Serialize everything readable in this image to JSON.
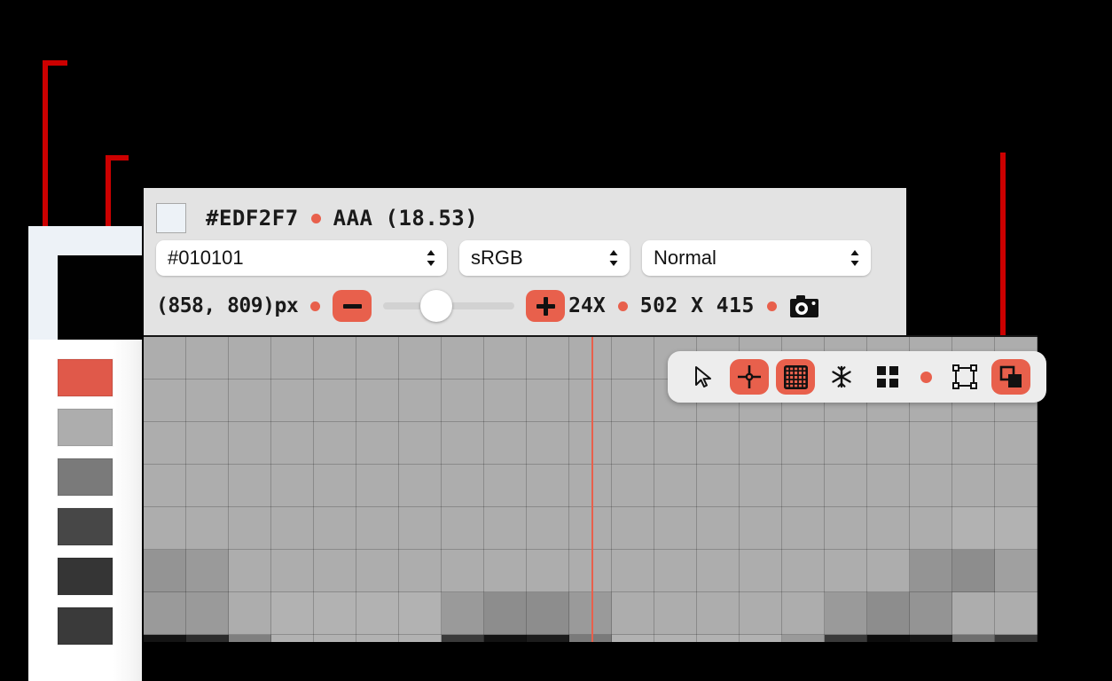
{
  "annotations": {
    "color": "#CC0000",
    "leaders": [
      {
        "name": "leader-palette-panel"
      },
      {
        "name": "leader-active-color-swatch"
      },
      {
        "name": "leader-layers-tool"
      }
    ]
  },
  "sidebar": {
    "active_color": "#010101",
    "panel_background": "#EDF2F7",
    "swatches": [
      {
        "name": "swatch-coral",
        "color": "#E0594A"
      },
      {
        "name": "swatch-light-gray",
        "color": "#ADADAD"
      },
      {
        "name": "swatch-mid-gray",
        "color": "#7A7A7A"
      },
      {
        "name": "swatch-dark-gray",
        "color": "#474747"
      },
      {
        "name": "swatch-darker-gray",
        "color": "#353535"
      },
      {
        "name": "swatch-near-black",
        "color": "#3A3A3A"
      }
    ]
  },
  "header": {
    "preview_color": "#EDF2F7",
    "hex_label": "#EDF2F7",
    "contrast_grade": "AAA",
    "contrast_ratio": "(18.53)",
    "accent_color": "#E8604C",
    "selects": [
      {
        "name": "color-hex-select",
        "value": "#010101",
        "icon": "chevron-updown-icon"
      },
      {
        "name": "color-space-select",
        "value": "sRGB",
        "icon": "chevron-updown-icon"
      },
      {
        "name": "blend-mode-select",
        "value": "Normal",
        "icon": "chevron-updown-icon"
      }
    ],
    "zoom_row": {
      "coordinates": "(858, 809)px",
      "zoom_out_icon": "minus-icon",
      "zoom_in_icon": "plus-icon",
      "zoom_level": "24X",
      "dimensions": "502 X 415",
      "camera_icon": "camera-icon",
      "slider_value": 30
    }
  },
  "toolbar": {
    "items": [
      {
        "name": "cursor-tool",
        "icon": "cursor-arrow-icon",
        "active": false
      },
      {
        "name": "crosshair-tool",
        "icon": "crosshair-icon",
        "active": true
      },
      {
        "name": "grid-tool",
        "icon": "grid-icon",
        "active": true
      },
      {
        "name": "freeze-tool",
        "icon": "snowflake-icon",
        "active": false
      },
      {
        "name": "quad-tool",
        "icon": "four-squares-icon",
        "active": false
      },
      {
        "name": "separator-dot",
        "icon": "dot-icon",
        "active": false
      },
      {
        "name": "crop-tool",
        "icon": "bounding-box-icon",
        "active": false
      },
      {
        "name": "layers-tool",
        "icon": "overlap-squares-icon",
        "active": true
      }
    ]
  },
  "canvas": {
    "grid_cell_size": 48,
    "columns": 21,
    "rows": 8,
    "crosshair_color": "#E8604C",
    "base_color": "#ADADAD",
    "pixels": [
      [
        "#ADADAD",
        "#ADADAD",
        "#ADADAD",
        "#ADADAD",
        "#ADADAD",
        "#ADADAD",
        "#ADADAD",
        "#ADADAD",
        "#ADADAD",
        "#ADADAD",
        "#ADADAD",
        "#ADADAD",
        "#ADADAD",
        "#ADADAD",
        "#ADADAD",
        "#ADADAD",
        "#ADADAD",
        "#ADADAD",
        "#ADADAD",
        "#ADADAD",
        "#ADADAD"
      ],
      [
        "#ADADAD",
        "#ADADAD",
        "#ADADAD",
        "#ADADAD",
        "#ADADAD",
        "#ADADAD",
        "#ADADAD",
        "#ADADAD",
        "#ADADAD",
        "#ADADAD",
        "#ADADAD",
        "#ADADAD",
        "#ADADAD",
        "#ADADAD",
        "#ADADAD",
        "#ADADAD",
        "#ADADAD",
        "#ADADAD",
        "#ADADAD",
        "#ADADAD",
        "#ADADAD"
      ],
      [
        "#ADADAD",
        "#ADADAD",
        "#ADADAD",
        "#ADADAD",
        "#ADADAD",
        "#ADADAD",
        "#ADADAD",
        "#ADADAD",
        "#ADADAD",
        "#ADADAD",
        "#ADADAD",
        "#ADADAD",
        "#ADADAD",
        "#ADADAD",
        "#ADADAD",
        "#ADADAD",
        "#ADADAD",
        "#ADADAD",
        "#ADADAD",
        "#ADADAD",
        "#ADADAD"
      ],
      [
        "#ADADAD",
        "#ADADAD",
        "#ADADAD",
        "#ADADAD",
        "#ADADAD",
        "#ADADAD",
        "#ADADAD",
        "#ADADAD",
        "#ADADAD",
        "#ADADAD",
        "#ADADAD",
        "#ADADAD",
        "#ADADAD",
        "#ADADAD",
        "#ADADAD",
        "#ADADAD",
        "#ADADAD",
        "#ADADAD",
        "#ADADAD",
        "#ADADAD",
        "#ADADAD"
      ],
      [
        "#ADADAD",
        "#ADADAD",
        "#ADADAD",
        "#ADADAD",
        "#ADADAD",
        "#ADADAD",
        "#ADADAD",
        "#ADADAD",
        "#ADADAD",
        "#ADADAD",
        "#ADADAD",
        "#ADADAD",
        "#ADADAD",
        "#ADADAD",
        "#ADADAD",
        "#ADADAD",
        "#ADADAD",
        "#ADADAD",
        "#ADADAD",
        "#B2B2B2",
        "#B2B2B2"
      ],
      [
        "#949494",
        "#9A9A9A",
        "#ADADAD",
        "#ADADAD",
        "#ADADAD",
        "#ADADAD",
        "#ADADAD",
        "#ADADAD",
        "#ADADAD",
        "#ADADAD",
        "#ADADAD",
        "#ADADAD",
        "#ADADAD",
        "#ADADAD",
        "#ADADAD",
        "#ADADAD",
        "#ADADAD",
        "#ADADAD",
        "#949494",
        "#8D8D8D",
        "#A0A0A0"
      ],
      [
        "#9A9A9A",
        "#9A9A9A",
        "#ADADAD",
        "#B2B2B2",
        "#B2B2B2",
        "#B2B2B2",
        "#B2B2B2",
        "#9A9A9A",
        "#8D8D8D",
        "#8D8D8D",
        "#9A9A9A",
        "#ADADAD",
        "#ADADAD",
        "#ADADAD",
        "#ADADAD",
        "#ADADAD",
        "#9A9A9A",
        "#8D8D8D",
        "#949494",
        "#ADADAD",
        "#ADADAD"
      ],
      [
        "#141414",
        "#2C2C2C",
        "#7F7F7F",
        "#B2B2B2",
        "#B2B2B2",
        "#B2B2B2",
        "#B2B2B2",
        "#3A3A3A",
        "#121212",
        "#1C1C1C",
        "#7A7A7A",
        "#B2B2B2",
        "#B2B2B2",
        "#B2B2B2",
        "#B2B2B2",
        "#9A9A9A",
        "#3A3A3A",
        "#0C0C0C",
        "#161616",
        "#6E6E6E",
        "#3A3A3A"
      ]
    ]
  }
}
